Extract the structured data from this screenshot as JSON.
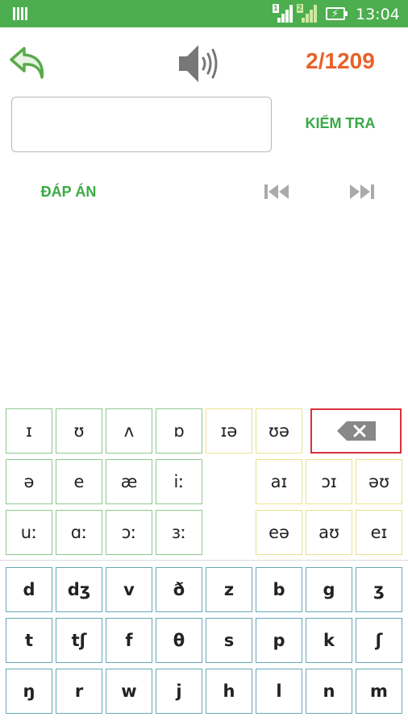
{
  "status_bar": {
    "time": "13:04",
    "sim1": "1",
    "sim2": "2",
    "color": "#4cae4f"
  },
  "header": {
    "back_icon": "undo-arrow-icon",
    "speaker_icon": "speaker-icon",
    "counter": "2/1209"
  },
  "answer": {
    "value": "",
    "check_label": "KIỂM TRA",
    "show_answer_label": "ĐÁP ÁN"
  },
  "navigation": {
    "prev_icon": "skip-previous-icon",
    "next_icon": "skip-next-icon"
  },
  "keyboard": {
    "vowel_row1": [
      "ɪ",
      "ʊ",
      "ʌ",
      "ɒ"
    ],
    "diphthong_row1": [
      "ɪə",
      "ʊə"
    ],
    "backspace_icon": "backspace-icon",
    "vowel_row2": [
      "ə",
      "e",
      "æ",
      "iː"
    ],
    "diphthong_row2": [
      "aɪ",
      "ɔɪ",
      "əʊ"
    ],
    "vowel_row3": [
      "uː",
      "ɑː",
      "ɔː",
      "ɜː"
    ],
    "diphthong_row3": [
      "eə",
      "aʊ",
      "eɪ"
    ],
    "consonant_row1": [
      "d",
      "dʒ",
      "v",
      "ð",
      "z",
      "b",
      "g",
      "ʒ"
    ],
    "consonant_row2": [
      "t",
      "tʃ",
      "f",
      "θ",
      "s",
      "p",
      "k",
      "ʃ"
    ],
    "consonant_row3": [
      "ŋ",
      "r",
      "w",
      "j",
      "h",
      "l",
      "n",
      "m"
    ]
  },
  "colors": {
    "accent_green": "#3aaa45",
    "counter_orange": "#e8622a",
    "backspace_red": "#d8303a"
  }
}
